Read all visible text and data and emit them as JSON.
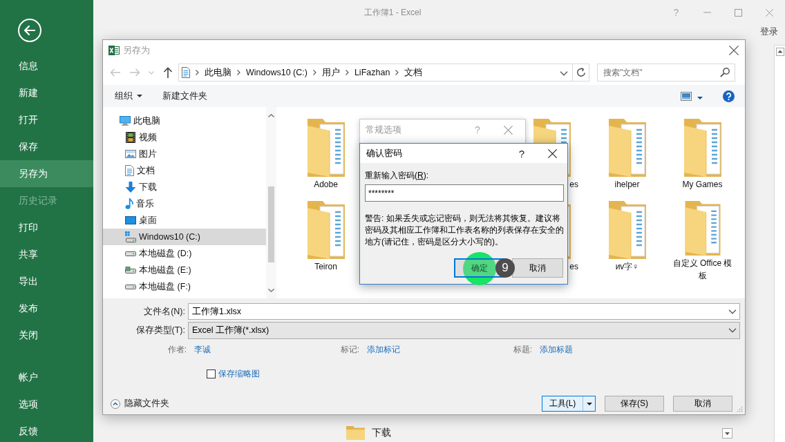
{
  "app": {
    "title": "工作簿1 - Excel",
    "help_button": "?",
    "sign_in": "登录"
  },
  "sidebar": {
    "items": [
      {
        "label": "信息",
        "selected": false,
        "disabled": false
      },
      {
        "label": "新建",
        "selected": false,
        "disabled": false
      },
      {
        "label": "打开",
        "selected": false,
        "disabled": false
      },
      {
        "label": "保存",
        "selected": false,
        "disabled": false
      },
      {
        "label": "另存为",
        "selected": true,
        "disabled": false
      },
      {
        "label": "历史记录",
        "selected": false,
        "disabled": true
      },
      {
        "label": "打印",
        "selected": false,
        "disabled": false
      },
      {
        "label": "共享",
        "selected": false,
        "disabled": false
      },
      {
        "label": "导出",
        "selected": false,
        "disabled": false
      },
      {
        "label": "发布",
        "selected": false,
        "disabled": false
      },
      {
        "label": "关闭",
        "selected": false,
        "disabled": false
      }
    ],
    "footer_items": [
      {
        "label": "帐户",
        "selected": false,
        "disabled": false
      },
      {
        "label": "选项",
        "selected": false,
        "disabled": false
      },
      {
        "label": "反馈",
        "selected": false,
        "disabled": false
      }
    ]
  },
  "backstage": {
    "recent_folder": "下载"
  },
  "save_dialog": {
    "title": "另存为",
    "breadcrumbs": [
      "此电脑",
      "Windows10 (C:)",
      "用户",
      "LiFazhan",
      "文档"
    ],
    "search": {
      "placeholder": "搜索\"文档\""
    },
    "toolbar": {
      "organize": "组织",
      "new_folder": "新建文件夹"
    },
    "nav": [
      {
        "label": "此电脑",
        "kind": "computer",
        "selected": false,
        "children": [
          {
            "label": "视频",
            "kind": "videos",
            "selected": false
          },
          {
            "label": "图片",
            "kind": "pictures",
            "selected": false
          },
          {
            "label": "文档",
            "kind": "documents",
            "selected": false
          },
          {
            "label": "下载",
            "kind": "downloads",
            "selected": false
          },
          {
            "label": "音乐",
            "kind": "music",
            "selected": false
          },
          {
            "label": "桌面",
            "kind": "desktop",
            "selected": false
          },
          {
            "label": "Windows10 (C:)",
            "kind": "system-drive",
            "selected": true
          },
          {
            "label": "本地磁盘 (D:)",
            "kind": "drive",
            "selected": false
          },
          {
            "label": "本地磁盘 (E:)",
            "kind": "drive-alt",
            "selected": false
          },
          {
            "label": "本地磁盘 (F:)",
            "kind": "drive",
            "selected": false
          }
        ]
      }
    ],
    "folder_rows": [
      {
        "start": [
          {
            "label": "Adobe",
            "clipped": false
          }
        ],
        "end": [
          {
            "label": "es",
            "clipped": true
          },
          {
            "label": "ihelper",
            "clipped": false
          },
          {
            "label": "My Games",
            "clipped": false
          }
        ]
      },
      {
        "start": [
          {
            "label": "Teiron",
            "clipped": false
          }
        ],
        "end": [
          {
            "label": "es",
            "clipped": true
          },
          {
            "label": "иv字♀",
            "clipped": false
          },
          {
            "label": "自定义 Office 模板",
            "clipped": false
          }
        ]
      }
    ],
    "filename": {
      "label": "文件名(N):",
      "value": "工作簿1.xlsx"
    },
    "filetype": {
      "label": "保存类型(T):",
      "value": "Excel 工作簿(*.xlsx)"
    },
    "meta": [
      {
        "label": "作者:",
        "value": "李诚"
      },
      {
        "label": "标记:",
        "value": "添加标记"
      },
      {
        "label": "标题:",
        "value": "添加标题"
      }
    ],
    "thumbnail": {
      "label": "保存缩略图",
      "checked": false
    },
    "hide_folders": "隐藏文件夹",
    "buttons": [
      {
        "label": "工具(L)",
        "kind": "split",
        "hovered": true
      },
      {
        "label": "保存(S)",
        "kind": "plain",
        "hovered": false
      },
      {
        "label": "取消",
        "kind": "plain",
        "hovered": false
      }
    ]
  },
  "general_options_dialog": {
    "title": "常规选项",
    "help_button": "?"
  },
  "confirm_dialog": {
    "title": "确认密码",
    "help_button": "?",
    "prompt": {
      "before": "重新输入密码(",
      "access_key": "R",
      "after": "):"
    },
    "password": "********",
    "warning": "警告: 如果丢失或忘记密码，则无法将其恢复。建议将密码及其相应工作簿和工作表名称的列表保存在安全的地方(请记住，密码是区分大小写的)。",
    "buttons": [
      {
        "label": "确定",
        "default": true
      },
      {
        "label": "取消",
        "default": false
      }
    ],
    "step_marker": "9"
  }
}
